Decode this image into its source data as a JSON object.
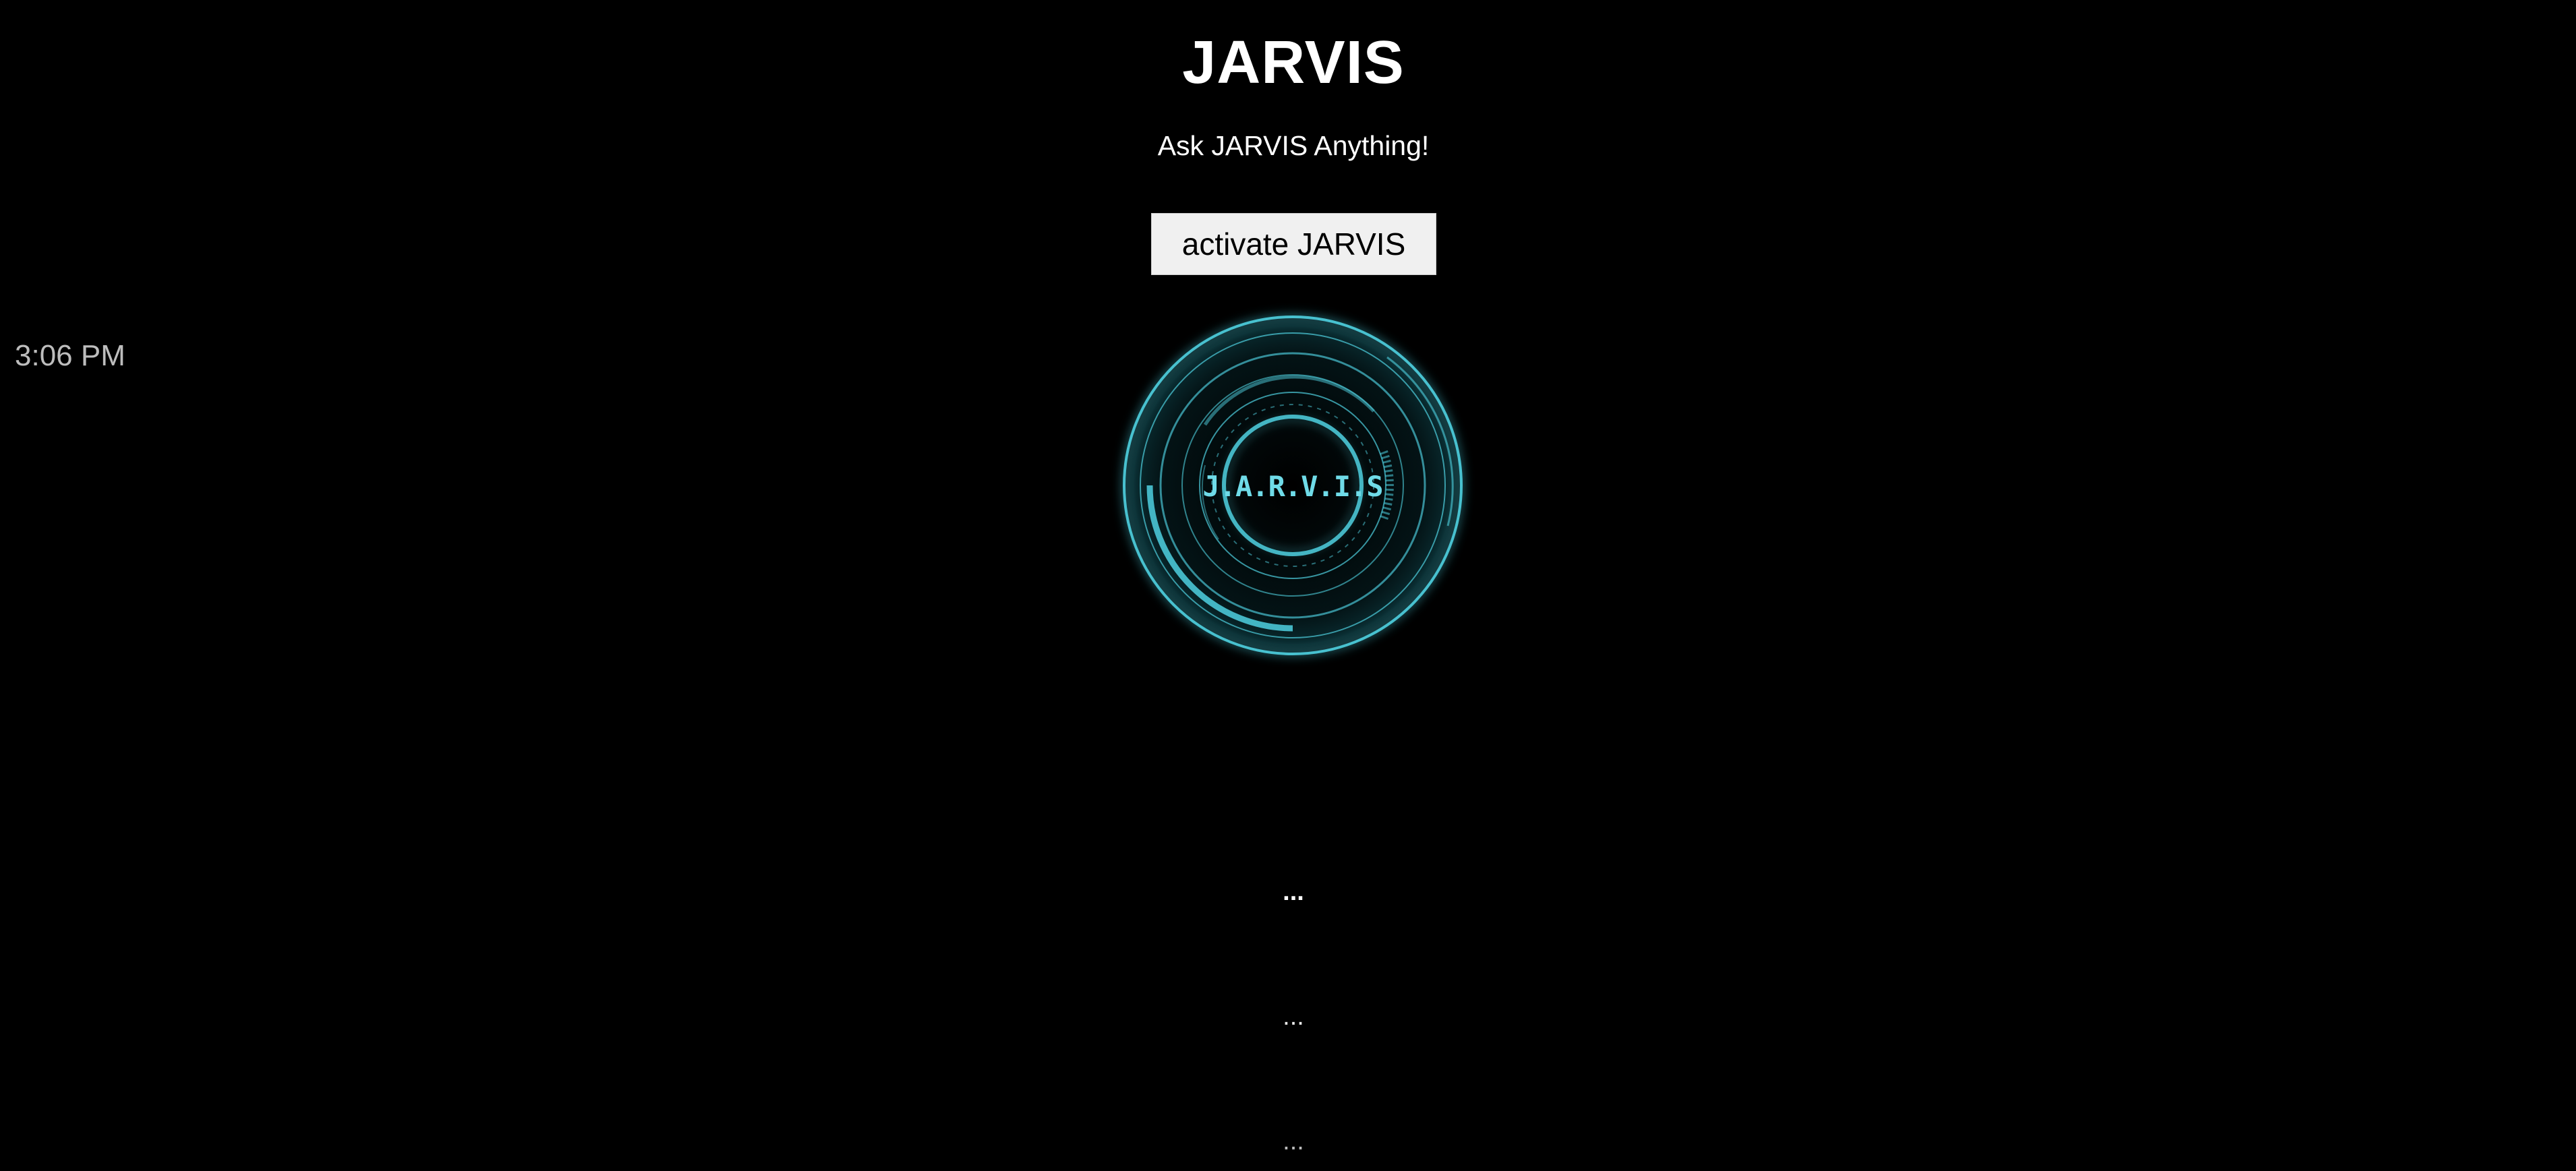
{
  "header": {
    "title": "JARVIS",
    "subtitle": "Ask JARVIS Anything!"
  },
  "controls": {
    "activate_label": "activate JARVIS"
  },
  "status": {
    "time": "3:06 PM"
  },
  "reactor": {
    "label": "J.A.R.V.I.S",
    "accent_color": "#4fd0e0"
  },
  "messages": [
    {
      "text": "..."
    },
    {
      "text": "..."
    },
    {
      "text": "..."
    }
  ]
}
